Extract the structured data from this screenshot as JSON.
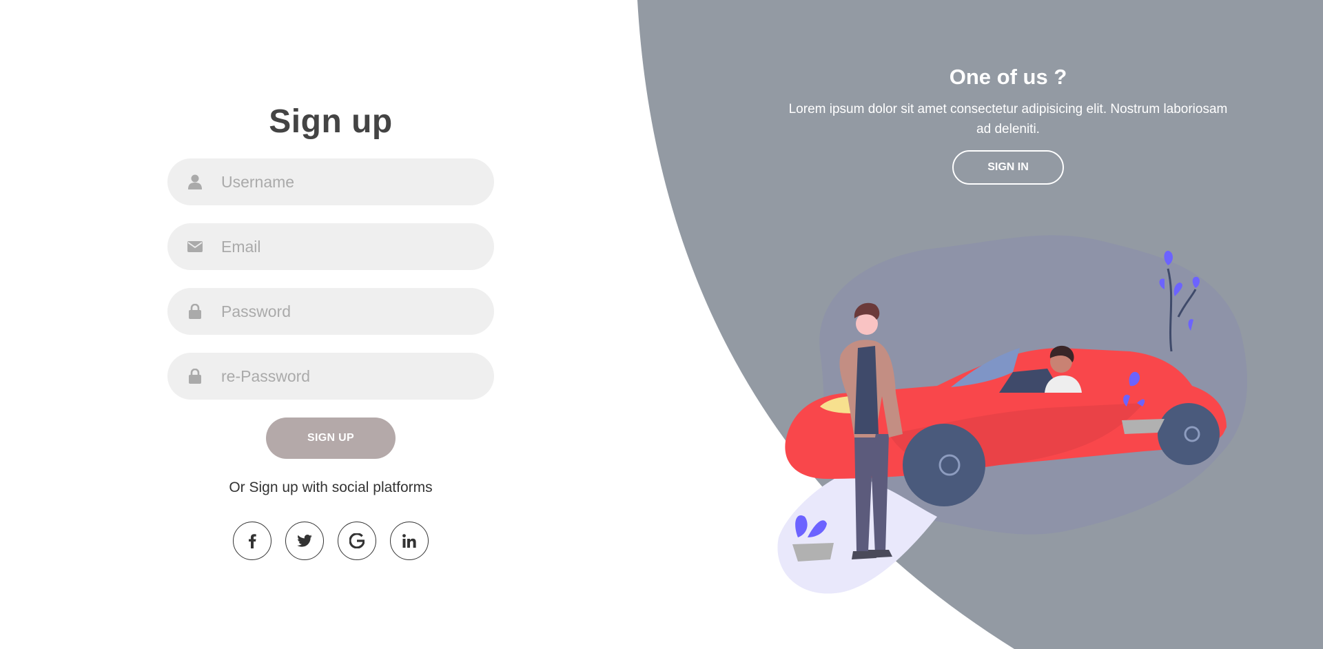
{
  "colors": {
    "panel_bg": "#939aa3",
    "signup_button": "#b4a9a9",
    "input_bg": "#efefef",
    "title_text": "#444444",
    "car_red": "#f9474b"
  },
  "signup": {
    "title": "Sign up",
    "fields": [
      {
        "icon": "user-icon",
        "placeholder": "Username",
        "value": ""
      },
      {
        "icon": "envelope-icon",
        "placeholder": "Email",
        "value": ""
      },
      {
        "icon": "lock-icon",
        "placeholder": "Password",
        "value": ""
      },
      {
        "icon": "lock-icon",
        "placeholder": "re-Password",
        "value": ""
      }
    ],
    "button_label": "SIGN UP",
    "social_text": "Or Sign up with social platforms",
    "social": [
      {
        "icon": "facebook-icon"
      },
      {
        "icon": "twitter-icon"
      },
      {
        "icon": "google-icon"
      },
      {
        "icon": "linkedin-icon"
      }
    ]
  },
  "panel": {
    "title": "One of us ?",
    "text": "Lorem ipsum dolor sit amet consectetur adipisicing elit. Nostrum laboriosam ad deleniti.",
    "button_label": "SIGN IN"
  }
}
